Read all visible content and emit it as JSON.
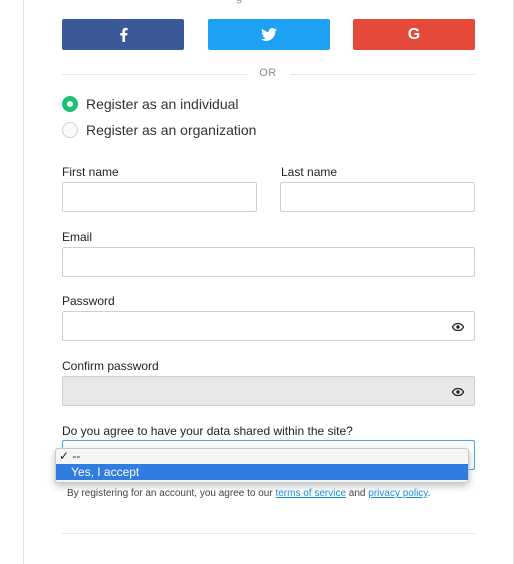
{
  "header_cut_text": "g",
  "social": {
    "facebook_icon": "facebook-f",
    "twitter_icon": "twitter-bird",
    "google_label": "G",
    "colors": {
      "facebook": "#3b5998",
      "twitter": "#1da1f2",
      "google": "#e5493a"
    }
  },
  "divider_text": "OR",
  "account_type": {
    "options": [
      "Register as an individual",
      "Register as an organization"
    ],
    "selected": "Register as an individual",
    "accent": "#1bbf75"
  },
  "form": {
    "first_name_label": "First name",
    "last_name_label": "Last name",
    "email_label": "Email",
    "password_label": "Password",
    "confirm_password_label": "Confirm password",
    "consent_label": "Do you agree to have your data shared within the site?"
  },
  "consent_dropdown": {
    "options": [
      "--",
      "Yes, I accept"
    ],
    "checked": "--",
    "highlighted": "Yes, I accept"
  },
  "terms": {
    "prefix": "By registering for an account, you agree to our ",
    "tos_link": "terms of service",
    "middle": " and ",
    "privacy_link": "privacy policy",
    "suffix": "."
  }
}
